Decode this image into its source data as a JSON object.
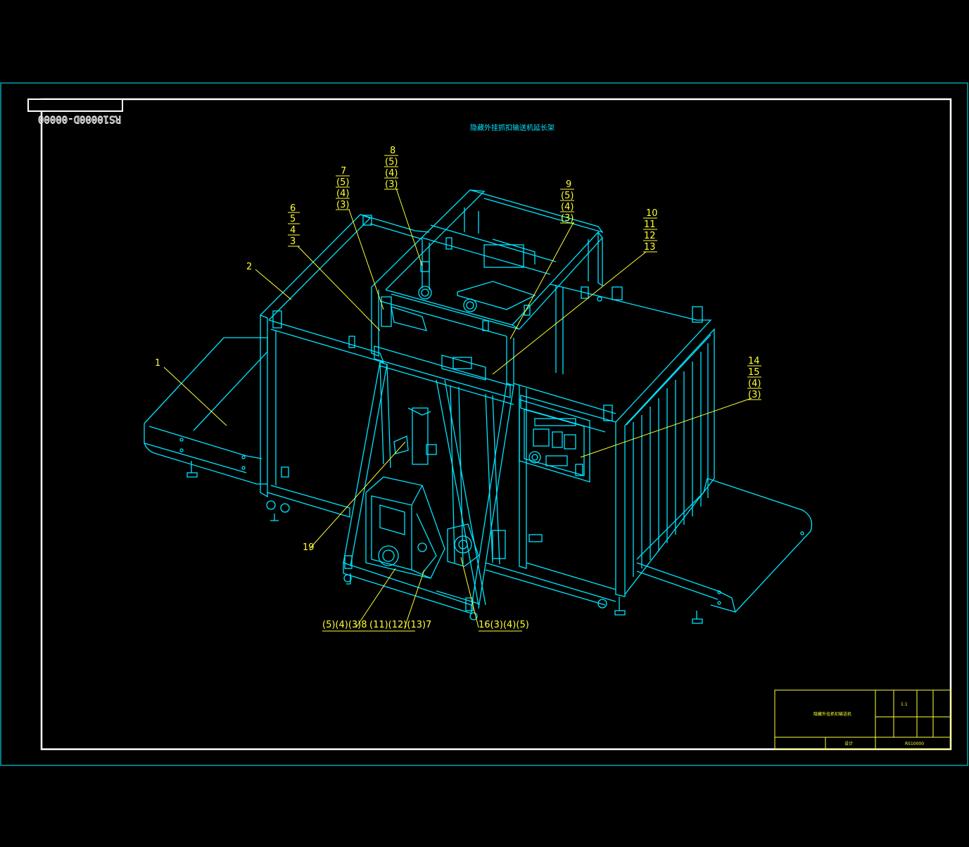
{
  "drawing": {
    "drawing_number": "RS10000D-00000",
    "title": "隐藏外挂抓扣输送机延长架",
    "callouts": {
      "c1": [
        "1"
      ],
      "c2": [
        "2"
      ],
      "c6": [
        "6",
        "5",
        "4",
        "3"
      ],
      "c7": [
        "7",
        "(5)",
        "(4)",
        "(3)"
      ],
      "c8": [
        "8",
        "(5)",
        "(4)",
        "(3)"
      ],
      "c9": [
        "9",
        "(5)",
        "(4)",
        "(3)"
      ],
      "c10": [
        "10",
        "11",
        "12",
        "13"
      ],
      "c14": [
        "14",
        "15",
        "(4)",
        "(3)"
      ],
      "c19": [
        "19"
      ],
      "b1": "(5)(4)(3)8",
      "b2": "(11)(12)(13)7",
      "b3": "16(3)(4)(5)"
    },
    "title_block": {
      "name": "隐藏外挂抓扣输送机",
      "cell_a": "1:1",
      "cell_b": "设计",
      "cell_c": "RS10000"
    }
  },
  "colors": {
    "background": "#000000",
    "linework": "#00e5ff",
    "annotation": "#ffff33",
    "border": "#ffffff"
  }
}
